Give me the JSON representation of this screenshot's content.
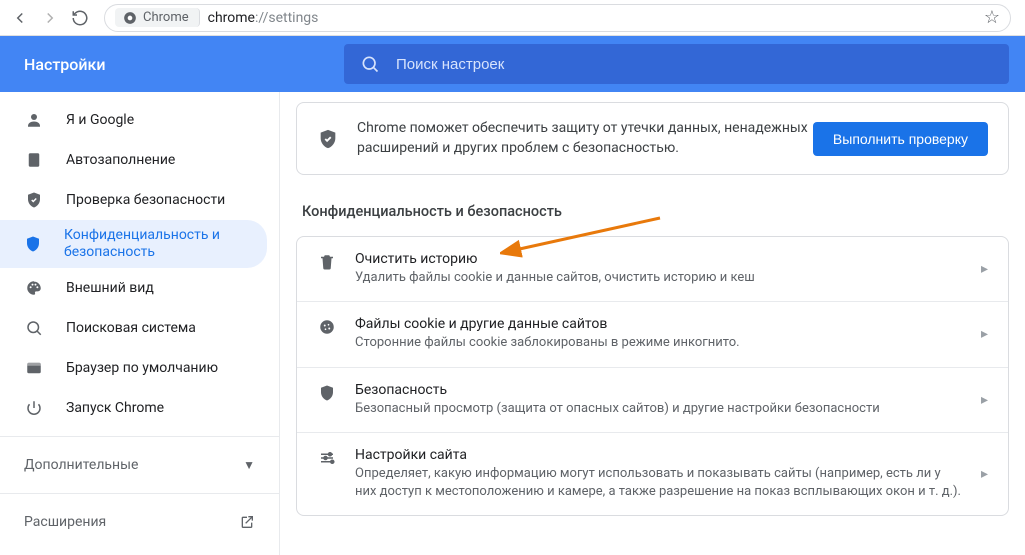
{
  "toolbar": {
    "chip_label": "Chrome",
    "url_display": "chrome://settings",
    "url_scheme": "chrome",
    "url_rest": "://settings"
  },
  "header": {
    "title": "Настройки",
    "search_placeholder": "Поиск настроек"
  },
  "sidebar": {
    "items": [
      {
        "icon": "person",
        "label": "Я и Google",
        "selected": false
      },
      {
        "icon": "autofill",
        "label": "Автозаполнение",
        "selected": false
      },
      {
        "icon": "shield-check",
        "label": "Проверка безопасности",
        "selected": false
      },
      {
        "icon": "shield",
        "label": "Конфиденциальность и безопасность",
        "selected": true,
        "twoline": true
      },
      {
        "icon": "palette",
        "label": "Внешний вид",
        "selected": false
      },
      {
        "icon": "search",
        "label": "Поисковая система",
        "selected": false
      },
      {
        "icon": "browser",
        "label": "Браузер по умолчанию",
        "selected": false
      },
      {
        "icon": "power",
        "label": "Запуск Chrome",
        "selected": false
      }
    ],
    "advanced_label": "Дополнительные",
    "extensions_label": "Расширения"
  },
  "main": {
    "safety_card": {
      "text": "Chrome поможет обеспечить защиту от утечки данных, ненадежных расширений и других проблем с безопасностью.",
      "button": "Выполнить проверку"
    },
    "section_title": "Конфиденциальность и безопасность",
    "rows": [
      {
        "icon": "trash",
        "title": "Очистить историю",
        "sub": "Удалить файлы cookie и данные сайтов, очистить историю и кеш"
      },
      {
        "icon": "cookie",
        "title": "Файлы cookie и другие данные сайтов",
        "sub": "Сторонние файлы cookie заблокированы в режиме инкогнито."
      },
      {
        "icon": "shield",
        "title": "Безопасность",
        "sub": "Безопасный просмотр (защита от опасных сайтов) и другие настройки безопасности"
      },
      {
        "icon": "tune",
        "title": "Настройки сайта",
        "sub": "Определяет, какую информацию могут использовать и показывать сайты (например, есть ли у них доступ к местоположению и камере, а также разрешение на показ всплывающих окон и т. д.)."
      }
    ]
  }
}
